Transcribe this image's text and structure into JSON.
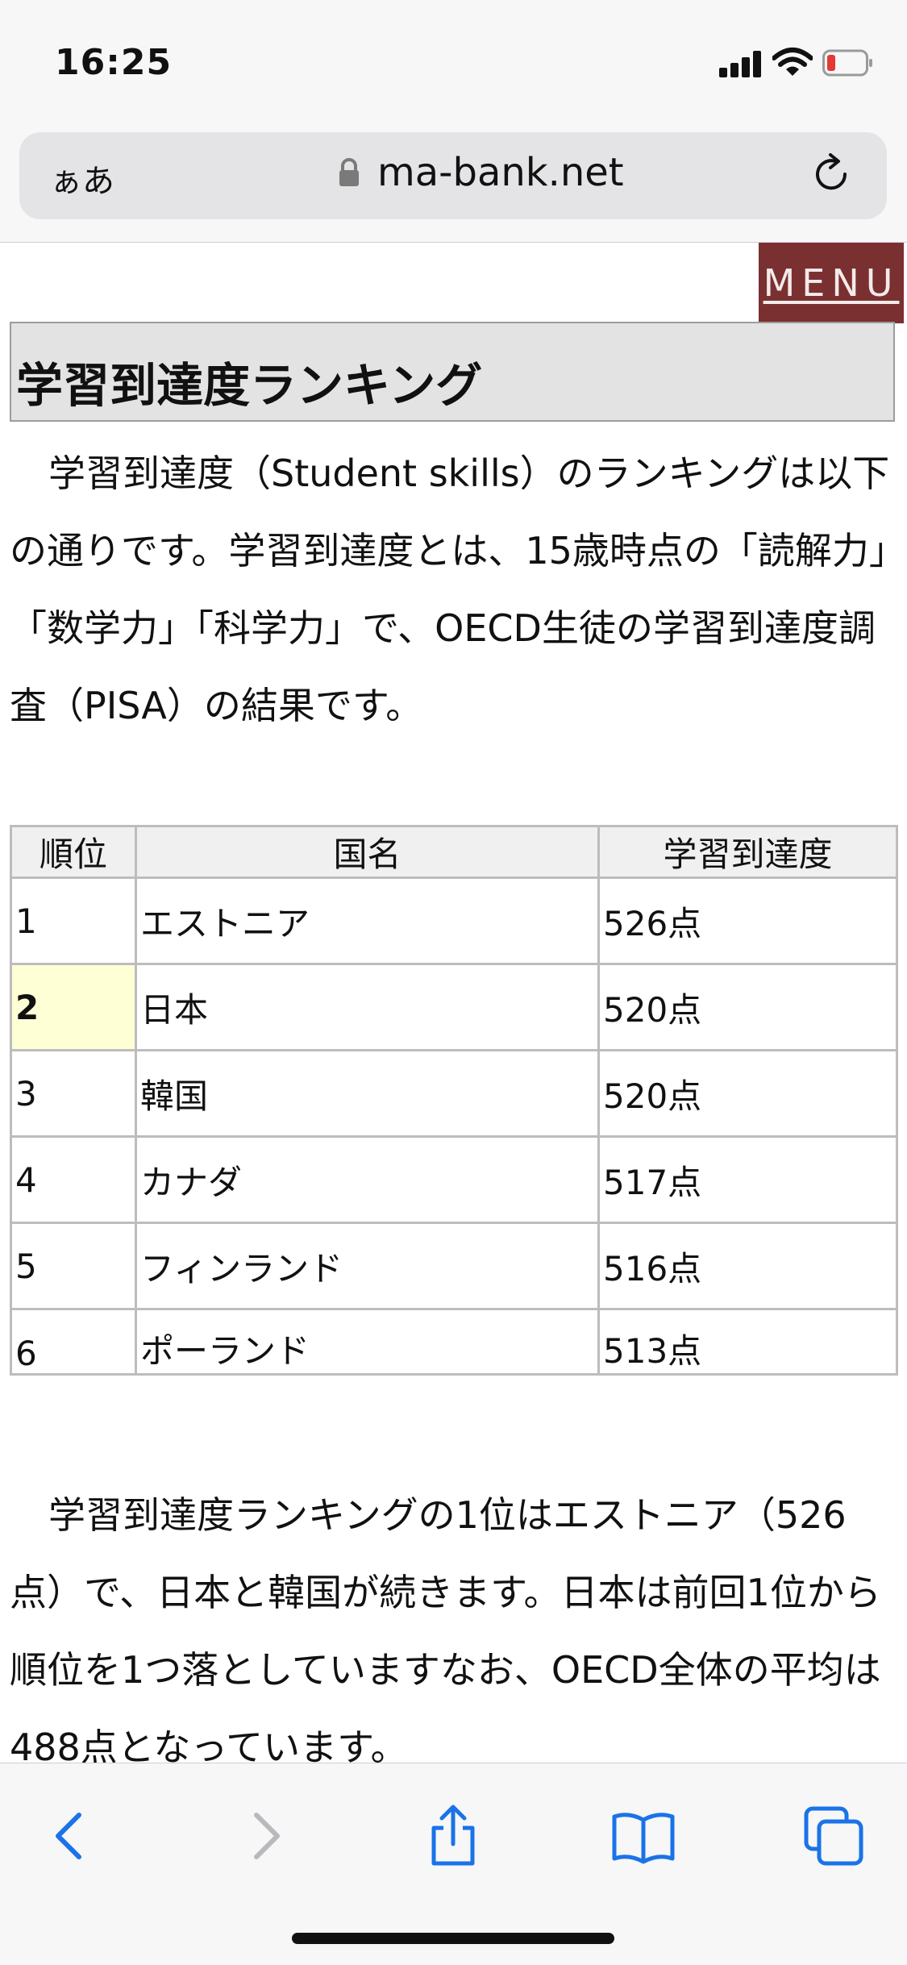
{
  "status_bar": {
    "time": "16:25"
  },
  "address_bar": {
    "aa_label": "ぁあ",
    "url": "ma-bank.net"
  },
  "header": {
    "menu_label": "MENU"
  },
  "page": {
    "title": "学習到達度ランキング",
    "intro": "学習到達度（Student skills）のランキングは以下の通りです。学習到達度とは、15歳時点の「読解力」「数学力」「科学力」で、OECD生徒の学習到達度調査（PISA）の結果です。",
    "summary": "学習到達度ランキングの1位はエストニア（526点）で、日本と韓国が続きます。日本は前回1位から順位を1つ落としていますなお、OECD全体の平均は488点となっています。"
  },
  "table": {
    "headers": [
      "順位",
      "国名",
      "学習到達度"
    ],
    "rows": [
      {
        "rank": "1",
        "country": "エストニア",
        "score": "526点"
      },
      {
        "rank": "2",
        "country": "日本",
        "score": "520点"
      },
      {
        "rank": "3",
        "country": "韓国",
        "score": "520点"
      },
      {
        "rank": "4",
        "country": "カナダ",
        "score": "517点"
      },
      {
        "rank": "5",
        "country": "フィンランド",
        "score": "516点"
      },
      {
        "rank": "6",
        "country": "ポーランド",
        "score": "513点"
      }
    ]
  },
  "colors": {
    "menu_bg": "#7a3030",
    "highlight_cell": "#ffffd6",
    "toolbar_accent": "#1a73e8",
    "battery_low": "#e53935"
  },
  "toolbar": {
    "icons": [
      "back-icon",
      "forward-icon",
      "share-icon",
      "bookmarks-icon",
      "tabs-icon"
    ]
  }
}
